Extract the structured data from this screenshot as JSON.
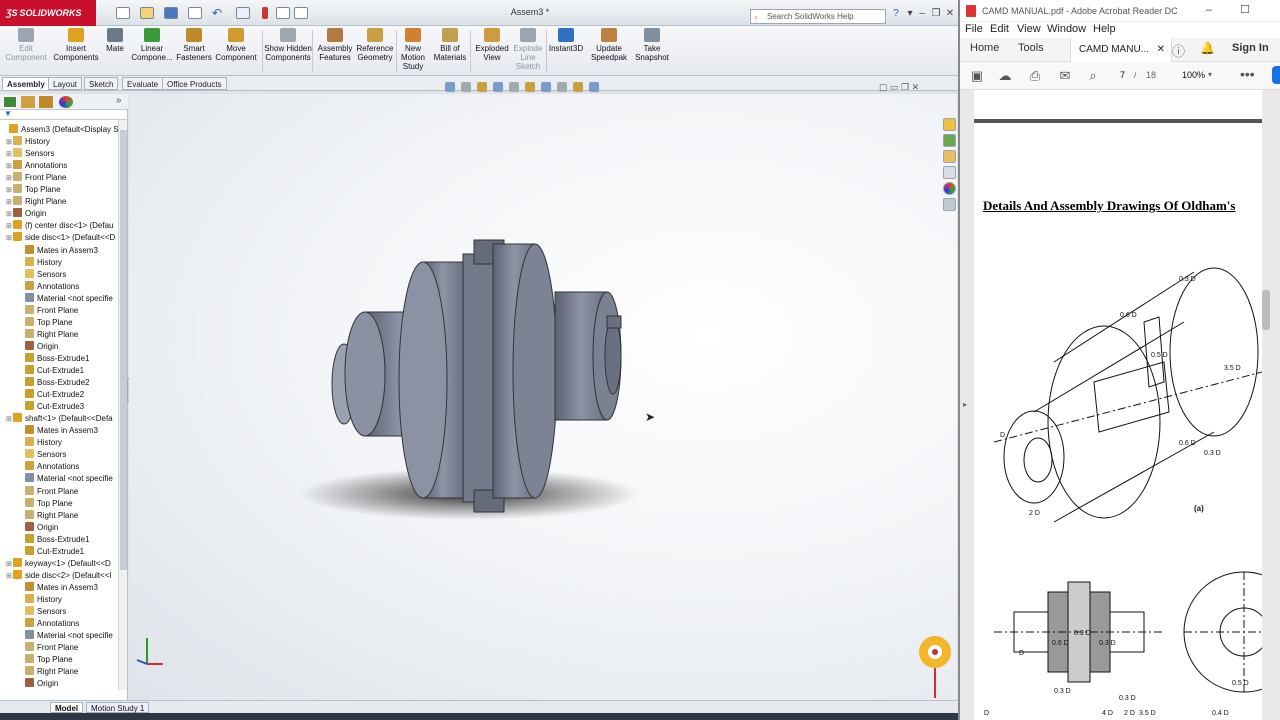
{
  "solidworks": {
    "brand": "SOLIDWORKS",
    "doc_title": "Assem3 *",
    "search_placeholder": "Search SolidWorks Help",
    "ribbon": [
      {
        "label": "Edit Component",
        "disabled": true,
        "color": "#9aa6b2"
      },
      {
        "label": "Insert Components",
        "disabled": false,
        "color": "#e0a020"
      },
      {
        "label": "Mate",
        "disabled": false,
        "color": "#6a7a8a"
      },
      {
        "label": "Linear Compone...",
        "disabled": false,
        "color": "#3a9a3a"
      },
      {
        "label": "Smart Fasteners",
        "disabled": false,
        "color": "#c08a2a"
      },
      {
        "label": "Move Component",
        "disabled": false,
        "color": "#d09a30"
      },
      {
        "label": "Show Hidden Components",
        "disabled": false,
        "color": "#a0a8b0"
      },
      {
        "label": "Assembly Features",
        "disabled": false,
        "color": "#b07a40"
      },
      {
        "label": "Reference Geometry",
        "disabled": false,
        "color": "#c8a040"
      },
      {
        "label": "New Motion Study",
        "disabled": false,
        "color": "#d08030"
      },
      {
        "label": "Bill of Materials",
        "disabled": false,
        "color": "#c0a050"
      },
      {
        "label": "Exploded View",
        "disabled": false,
        "color": "#d09a40"
      },
      {
        "label": "Explode Line Sketch",
        "disabled": true,
        "color": "#9aa6b2"
      },
      {
        "label": "Instant3D",
        "disabled": false,
        "color": "#3070c0"
      },
      {
        "label": "Update Speedpak",
        "disabled": false,
        "color": "#c08040"
      },
      {
        "label": "Take Snapshot",
        "disabled": false,
        "color": "#8090a0"
      }
    ],
    "tabs": [
      "Assembly",
      "Layout",
      "Sketch",
      "Evaluate",
      "Office Products"
    ],
    "active_tab": "Assembly",
    "tree": [
      {
        "label": "Assem3  (Default<Display St",
        "level": 0,
        "icon": "assembly-icon",
        "color": "#e0a020"
      },
      {
        "label": "History",
        "level": 1,
        "icon": "history-icon",
        "color": "#d8b050"
      },
      {
        "label": "Sensors",
        "level": 1,
        "icon": "sensor-icon",
        "color": "#e0c060"
      },
      {
        "label": "Annotations",
        "level": 1,
        "icon": "annotation-icon",
        "color": "#d0a040"
      },
      {
        "label": "Front Plane",
        "level": 1,
        "icon": "plane-icon",
        "color": "#c8b070"
      },
      {
        "label": "Top Plane",
        "level": 1,
        "icon": "plane-icon",
        "color": "#c8b070"
      },
      {
        "label": "Right Plane",
        "level": 1,
        "icon": "plane-icon",
        "color": "#c8b070"
      },
      {
        "label": "Origin",
        "level": 1,
        "icon": "origin-icon",
        "color": "#a06040"
      },
      {
        "label": "(f) center disc<1> (Defau",
        "level": 1,
        "icon": "part-icon",
        "color": "#e0a020"
      },
      {
        "label": "side disc<1> (Default<<D",
        "level": 1,
        "icon": "part-icon",
        "color": "#e0a020"
      },
      {
        "label": "Mates in Assem3",
        "level": 2,
        "icon": "mates-icon",
        "color": "#c09030"
      },
      {
        "label": "History",
        "level": 2,
        "icon": "history-icon",
        "color": "#d8b050"
      },
      {
        "label": "Sensors",
        "level": 2,
        "icon": "sensor-icon",
        "color": "#e0c060"
      },
      {
        "label": "Annotations",
        "level": 2,
        "icon": "annotation-icon",
        "color": "#d0a040"
      },
      {
        "label": "Material <not specifie",
        "level": 2,
        "icon": "material-icon",
        "color": "#8090a0"
      },
      {
        "label": "Front Plane",
        "level": 2,
        "icon": "plane-icon",
        "color": "#c8b070"
      },
      {
        "label": "Top Plane",
        "level": 2,
        "icon": "plane-icon",
        "color": "#c8b070"
      },
      {
        "label": "Right Plane",
        "level": 2,
        "icon": "plane-icon",
        "color": "#c8b070"
      },
      {
        "label": "Origin",
        "level": 2,
        "icon": "origin-icon",
        "color": "#a06040"
      },
      {
        "label": "Boss-Extrude1",
        "level": 2,
        "icon": "feature-icon",
        "color": "#c8a030"
      },
      {
        "label": "Cut-Extrude1",
        "level": 2,
        "icon": "feature-icon",
        "color": "#c8a030"
      },
      {
        "label": "Boss-Extrude2",
        "level": 2,
        "icon": "feature-icon",
        "color": "#c8a030"
      },
      {
        "label": "Cut-Extrude2",
        "level": 2,
        "icon": "feature-icon",
        "color": "#c8a030"
      },
      {
        "label": "Cut-Extrude3",
        "level": 2,
        "icon": "feature-icon",
        "color": "#c8a030"
      },
      {
        "label": "shaft<1> (Default<<Defa",
        "level": 1,
        "icon": "part-icon",
        "color": "#e0a020"
      },
      {
        "label": "Mates in Assem3",
        "level": 2,
        "icon": "mates-icon",
        "color": "#c09030"
      },
      {
        "label": "History",
        "level": 2,
        "icon": "history-icon",
        "color": "#d8b050"
      },
      {
        "label": "Sensors",
        "level": 2,
        "icon": "sensor-icon",
        "color": "#e0c060"
      },
      {
        "label": "Annotations",
        "level": 2,
        "icon": "annotation-icon",
        "color": "#d0a040"
      },
      {
        "label": "Material <not specifie",
        "level": 2,
        "icon": "material-icon",
        "color": "#8090a0"
      },
      {
        "label": "Front Plane",
        "level": 2,
        "icon": "plane-icon",
        "color": "#c8b070"
      },
      {
        "label": "Top Plane",
        "level": 2,
        "icon": "plane-icon",
        "color": "#c8b070"
      },
      {
        "label": "Right Plane",
        "level": 2,
        "icon": "plane-icon",
        "color": "#c8b070"
      },
      {
        "label": "Origin",
        "level": 2,
        "icon": "origin-icon",
        "color": "#a06040"
      },
      {
        "label": "Boss-Extrude1",
        "level": 2,
        "icon": "feature-icon",
        "color": "#c8a030"
      },
      {
        "label": "Cut-Extrude1",
        "level": 2,
        "icon": "feature-icon",
        "color": "#c8a030"
      },
      {
        "label": "keyway<1> (Default<<D",
        "level": 1,
        "icon": "part-icon",
        "color": "#e0a020"
      },
      {
        "label": "side disc<2> (Default<<l",
        "level": 1,
        "icon": "part-icon",
        "color": "#e0a020"
      },
      {
        "label": "Mates in Assem3",
        "level": 2,
        "icon": "mates-icon",
        "color": "#c09030"
      },
      {
        "label": "History",
        "level": 2,
        "icon": "history-icon",
        "color": "#d8b050"
      },
      {
        "label": "Sensors",
        "level": 2,
        "icon": "sensor-icon",
        "color": "#e0c060"
      },
      {
        "label": "Annotations",
        "level": 2,
        "icon": "annotation-icon",
        "color": "#d0a040"
      },
      {
        "label": "Material <not specifie",
        "level": 2,
        "icon": "material-icon",
        "color": "#8090a0"
      },
      {
        "label": "Front Plane",
        "level": 2,
        "icon": "plane-icon",
        "color": "#c8b070"
      },
      {
        "label": "Top Plane",
        "level": 2,
        "icon": "plane-icon",
        "color": "#c8b070"
      },
      {
        "label": "Right Plane",
        "level": 2,
        "icon": "plane-icon",
        "color": "#c8b070"
      },
      {
        "label": "Origin",
        "level": 2,
        "icon": "origin-icon",
        "color": "#a06040"
      }
    ],
    "status_tabs": [
      "Model",
      "Motion Study 1"
    ]
  },
  "acrobat": {
    "window_title": "CAMD MANUAL.pdf - Adobe Acrobat Reader DC",
    "menu": [
      "File",
      "Edit",
      "View",
      "Window",
      "Help"
    ],
    "home_tab": "Home",
    "tools_tab": "Tools",
    "doc_tab": "CAMD MANU...",
    "sign_in": "Sign In",
    "page_current": "7",
    "page_sep": "/",
    "page_total": "18",
    "zoom": "100%",
    "pdf_heading": "Details And Assembly Drawings Of Oldham's",
    "fig_label": "(a)",
    "dims": [
      "0.3 D",
      "0.6 D",
      "0.5 D",
      "3.5 D",
      "D",
      "2 D",
      "0.6 D",
      "0.3 D",
      "D",
      "0.6 D",
      "0.3 D",
      "0.3 D",
      "0.3 D",
      "4 D",
      "2 D",
      "3.5 D",
      "D",
      "0.5 D",
      "0.4 D",
      "0.3 D"
    ]
  }
}
